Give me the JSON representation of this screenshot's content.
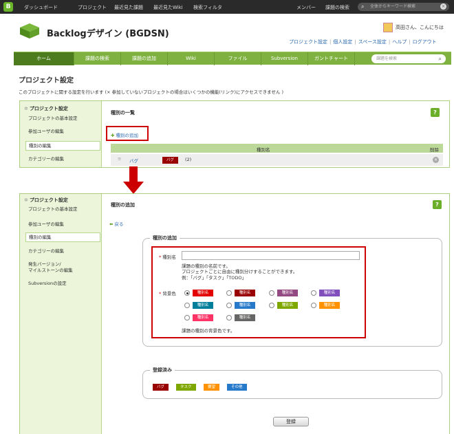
{
  "topbar": {
    "logo": "B",
    "nav": [
      "ダッシュボード",
      "プロジェクト",
      "最近見た課題",
      "最近見たWiki",
      "検索フィルタ"
    ],
    "right": [
      "メンバー",
      "課題の検索"
    ],
    "search_placeholder": "全体からキーワード検索"
  },
  "header": {
    "project_title": "Backlogデザイン (BGDSN)",
    "greeting": "高田さん、こんにちは",
    "links": [
      "プロジェクト設定",
      "個人設定",
      "スペース設定",
      "ヘルプ",
      "ログアウト"
    ]
  },
  "main_nav": {
    "tabs": [
      "ホーム",
      "課題の検索",
      "課題の追加",
      "Wiki",
      "ファイル",
      "Subversion",
      "ガントチャート"
    ],
    "search_placeholder": "課題を検索"
  },
  "page": {
    "title": "プロジェクト設定",
    "description": "このプロジェクトに関する設定を行います (× 参加していないプロジェクトの場合はいくつかの機能(リンク)にアクセスできません )"
  },
  "sidebar": {
    "heading": "プロジェクト設定",
    "items": [
      "プロジェクトの基本設定",
      "参加ユーザの編集",
      "種別の編集",
      "カテゴリーの編集",
      "発生バージョン/",
      "マイルストーンの編集",
      "Subversionの設定"
    ]
  },
  "panel1": {
    "title": "種別の一覧",
    "help": "?",
    "add_link": "種別の追加",
    "col_name": "種別名",
    "col_delete": "削除",
    "row": {
      "name": "バグ",
      "badge": "バグ",
      "count": "(2)"
    }
  },
  "panel2": {
    "title": "種別の追加",
    "help": "?",
    "back": "戻る",
    "form_legend": "種別の追加",
    "name_label": "種別名",
    "name_value": "",
    "name_help": [
      "課題の種別の名前です。",
      "プロジェクトごとに自由に種別分けすることができます。",
      "例：「バグ」「タスク」「TODO」"
    ],
    "color_label": "背景色",
    "swatch_label": "種別名",
    "colors": [
      "#e30000",
      "#990000",
      "#934981",
      "#814fbc",
      "#007e9a",
      "#2779ca",
      "#7ea800",
      "#ff9200",
      "#ff3265",
      "#666665"
    ],
    "color_help": "課題の種別の背景色です。",
    "registered_legend": "登録済み",
    "registered": [
      {
        "name": "バグ",
        "color": "#990000"
      },
      {
        "name": "タスク",
        "color": "#7ea800"
      },
      {
        "name": "要望",
        "color": "#ff9200"
      },
      {
        "name": "その他",
        "color": "#2779ca"
      }
    ],
    "submit": "登録"
  }
}
